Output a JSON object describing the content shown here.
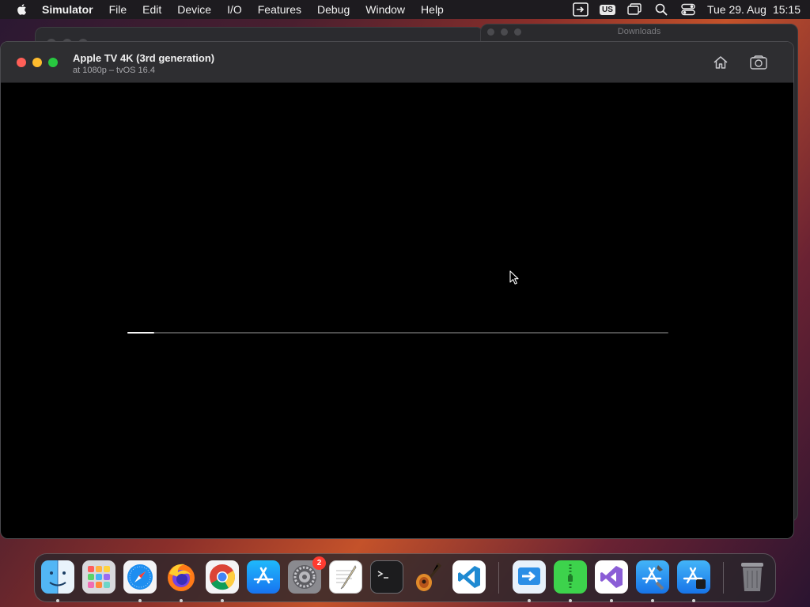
{
  "menubar": {
    "app_name": "Simulator",
    "items": [
      "File",
      "Edit",
      "Device",
      "I/O",
      "Features",
      "Debug",
      "Window",
      "Help"
    ],
    "input_source": "US",
    "date": "Tue 29. Aug",
    "time": "15:15"
  },
  "downloads_window": {
    "title": "Downloads"
  },
  "simulator": {
    "device_name": "Apple TV 4K (3rd generation)",
    "device_detail": "at 1080p – tvOS 16.4",
    "boot_progress": 0.05
  },
  "dock": {
    "items": [
      {
        "name": "finder-icon",
        "running": true
      },
      {
        "name": "launchpad-icon",
        "running": false
      },
      {
        "name": "safari-icon",
        "running": true
      },
      {
        "name": "firefox-icon",
        "running": true
      },
      {
        "name": "chrome-icon",
        "running": true
      },
      {
        "name": "app-store-icon",
        "running": false
      },
      {
        "name": "system-settings-icon",
        "running": false,
        "badge": "2"
      },
      {
        "name": "textedit-icon",
        "running": false
      },
      {
        "name": "terminal-icon",
        "running": false
      },
      {
        "name": "garageband-icon",
        "running": false
      },
      {
        "name": "vscode-icon",
        "running": false
      },
      {
        "name": "migration-assistant-icon",
        "running": true
      },
      {
        "name": "archive-utility-icon",
        "running": true
      },
      {
        "name": "visual-studio-icon",
        "running": true
      },
      {
        "name": "xcode-icon",
        "running": true
      },
      {
        "name": "simulator-icon",
        "running": true
      },
      {
        "name": "trash-icon",
        "running": false
      }
    ]
  },
  "colors": {
    "close": "#ff5f57",
    "minimize": "#febc2e",
    "maximize": "#28c840",
    "badge": "#ff3b30"
  }
}
